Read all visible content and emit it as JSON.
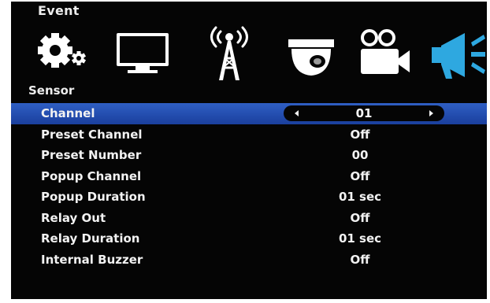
{
  "header": {
    "title": "Event"
  },
  "icons": [
    {
      "name": "gear-icon",
      "active": false
    },
    {
      "name": "monitor-icon",
      "active": false
    },
    {
      "name": "antenna-icon",
      "active": false
    },
    {
      "name": "dome-camera-icon",
      "active": false
    },
    {
      "name": "video-camera-icon",
      "active": false
    },
    {
      "name": "megaphone-icon",
      "active": true
    }
  ],
  "section": {
    "label": "Sensor"
  },
  "settings": [
    {
      "label": "Channel",
      "value": "01",
      "selected": true
    },
    {
      "label": "Preset Channel",
      "value": "Off"
    },
    {
      "label": "Preset Number",
      "value": "00"
    },
    {
      "label": "Popup Channel",
      "value": "Off"
    },
    {
      "label": "Popup Duration",
      "value": "01 sec"
    },
    {
      "label": "Relay Out",
      "value": "Off"
    },
    {
      "label": "Relay Duration",
      "value": "01 sec"
    },
    {
      "label": "Internal Buzzer",
      "value": "Off"
    }
  ],
  "colors": {
    "background": "#050505",
    "text": "#f2f2f2",
    "selection": "#2a52b8",
    "active_icon": "#2ea8e0"
  }
}
